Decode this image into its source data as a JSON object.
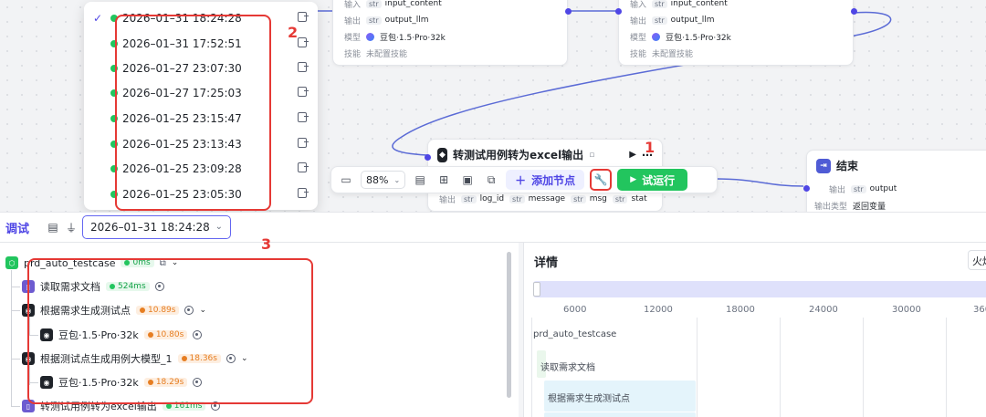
{
  "canvas": {
    "top_nodes": [
      {
        "input_tag": "str",
        "input_val": "input_content",
        "output_label": "输出",
        "output_tag": "str",
        "output_val": "output_llm",
        "model_label": "模型",
        "model_val": "豆包·1.5·Pro·32k",
        "skills_label": "技能",
        "skills_val": "未配置技能"
      },
      {
        "input_tag": "str",
        "input_val": "input_content",
        "output_label": "输出",
        "output_tag": "str",
        "output_val": "output_llm",
        "model_label": "模型",
        "model_val": "豆包·1.5·Pro·32k",
        "skills_label": "技能",
        "skills_val": "未配置技能"
      }
    ],
    "convert_node": {
      "title": "转测试用例转为excel输出",
      "output_label": "输出",
      "out_tags": [
        "str",
        "str",
        "str",
        "str"
      ],
      "out_vals": [
        "log_id",
        "message",
        "msg",
        "stat"
      ]
    },
    "end_node": {
      "title": "结束",
      "output_label": "输出",
      "output_tag": "str",
      "output_val": "output",
      "return_label": "输出类型",
      "return_val": "返回变量"
    }
  },
  "toolbar": {
    "zoom": "88%",
    "add_node_label": "添加节点",
    "run_label": "试运行"
  },
  "history_dropdown": {
    "items": [
      {
        "time": "2026–01–31 18:24:28",
        "selected": true
      },
      {
        "time": "2026–01–31 17:52:51",
        "selected": false
      },
      {
        "time": "2026–01–27 23:07:30",
        "selected": false
      },
      {
        "time": "2026–01–27 17:25:03",
        "selected": false
      },
      {
        "time": "2026–01–25 23:15:47",
        "selected": false
      },
      {
        "time": "2026–01–25 23:13:43",
        "selected": false
      },
      {
        "time": "2026–01–25 23:09:28",
        "selected": false
      },
      {
        "time": "2026–01–25 23:05:30",
        "selected": false
      }
    ]
  },
  "annotations": {
    "label1": "1",
    "label2": "2",
    "label3": "3",
    "color": "#e53935"
  },
  "debug": {
    "title": "调试",
    "selected_run": "2026–01–31 18:24:28"
  },
  "trace": {
    "root": {
      "name": "prd_auto_testcase",
      "time": "0ms"
    },
    "rows": [
      {
        "name": "读取需求文档",
        "time": "524ms",
        "kind": "green"
      },
      {
        "name": "根据需求生成测试点",
        "time": "10.89s",
        "kind": "orange"
      },
      {
        "name": "豆包·1.5·Pro·32k",
        "time": "10.80s",
        "kind": "orange"
      },
      {
        "name": "根据测试点生成用例大模型_1",
        "time": "18.36s",
        "kind": "orange"
      },
      {
        "name": "豆包·1.5·Pro·32k",
        "time": "18.29s",
        "kind": "orange"
      },
      {
        "name": "转测试用例转为excel输出",
        "time": "161ms",
        "kind": "green"
      }
    ]
  },
  "detail": {
    "title": "详情",
    "fire_label": "火焰",
    "ticks": [
      "6000",
      "12000",
      "18000",
      "24000",
      "30000",
      "360"
    ],
    "gantt": [
      "prd_auto_testcase",
      "读取需求文档",
      "根据需求生成测试点"
    ]
  },
  "colors": {
    "accent": "#4f46e5",
    "success": "#22c55e",
    "warning": "#e67e22"
  }
}
